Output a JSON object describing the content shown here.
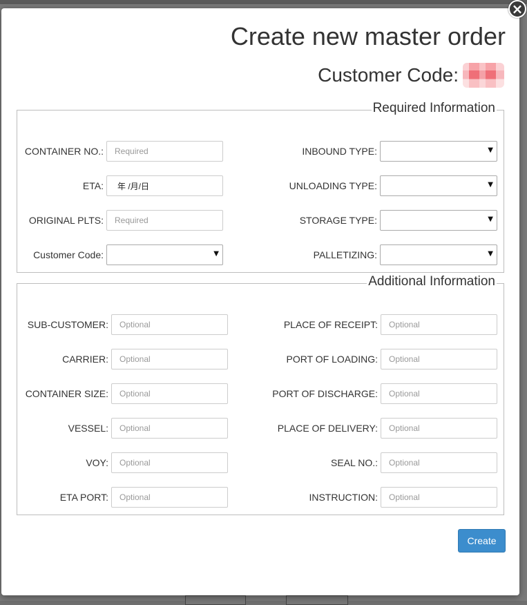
{
  "modal": {
    "close_glyph": "×",
    "title": "Create new master order",
    "customer_code_label": "Customer Code:"
  },
  "required": {
    "legend": "Required Information",
    "left": [
      {
        "label": "CONTAINER NO.:",
        "kind": "input",
        "placeholder": "Required"
      },
      {
        "label": "ETA:",
        "kind": "date",
        "value": "年 /月/日"
      },
      {
        "label": "ORIGINAL PLTS:",
        "kind": "input",
        "placeholder": "Required"
      },
      {
        "label": "Customer Code:",
        "kind": "select",
        "value": ""
      }
    ],
    "right": [
      {
        "label": "INBOUND TYPE:",
        "value": ""
      },
      {
        "label": "UNLOADING TYPE:",
        "value": ""
      },
      {
        "label": "STORAGE TYPE:",
        "value": ""
      },
      {
        "label": "PALLETIZING:",
        "value": ""
      }
    ]
  },
  "additional": {
    "legend": "Additional Information",
    "left": [
      {
        "label": "SUB-CUSTOMER:",
        "placeholder": "Optional"
      },
      {
        "label": "CARRIER:",
        "placeholder": "Optional"
      },
      {
        "label": "CONTAINER SIZE:",
        "placeholder": "Optional"
      },
      {
        "label": "VESSEL:",
        "placeholder": "Optional"
      },
      {
        "label": "VOY:",
        "placeholder": "Optional"
      },
      {
        "label": "ETA PORT:",
        "placeholder": "Optional"
      }
    ],
    "right": [
      {
        "label": "PLACE OF RECEIPT:",
        "placeholder": "Optional"
      },
      {
        "label": "PORT OF LOADING:",
        "placeholder": "Optional"
      },
      {
        "label": "PORT OF DISCHARGE:",
        "placeholder": "Optional"
      },
      {
        "label": "PLACE OF DELIVERY:",
        "placeholder": "Optional"
      },
      {
        "label": "SEAL NO.:",
        "placeholder": "Optional"
      },
      {
        "label": "INSTRUCTION:",
        "placeholder": "Optional"
      }
    ]
  },
  "actions": {
    "create_label": "Create"
  },
  "colors": {
    "primary_button": "#3c8dcd",
    "overlay": "#6f6f6f"
  }
}
